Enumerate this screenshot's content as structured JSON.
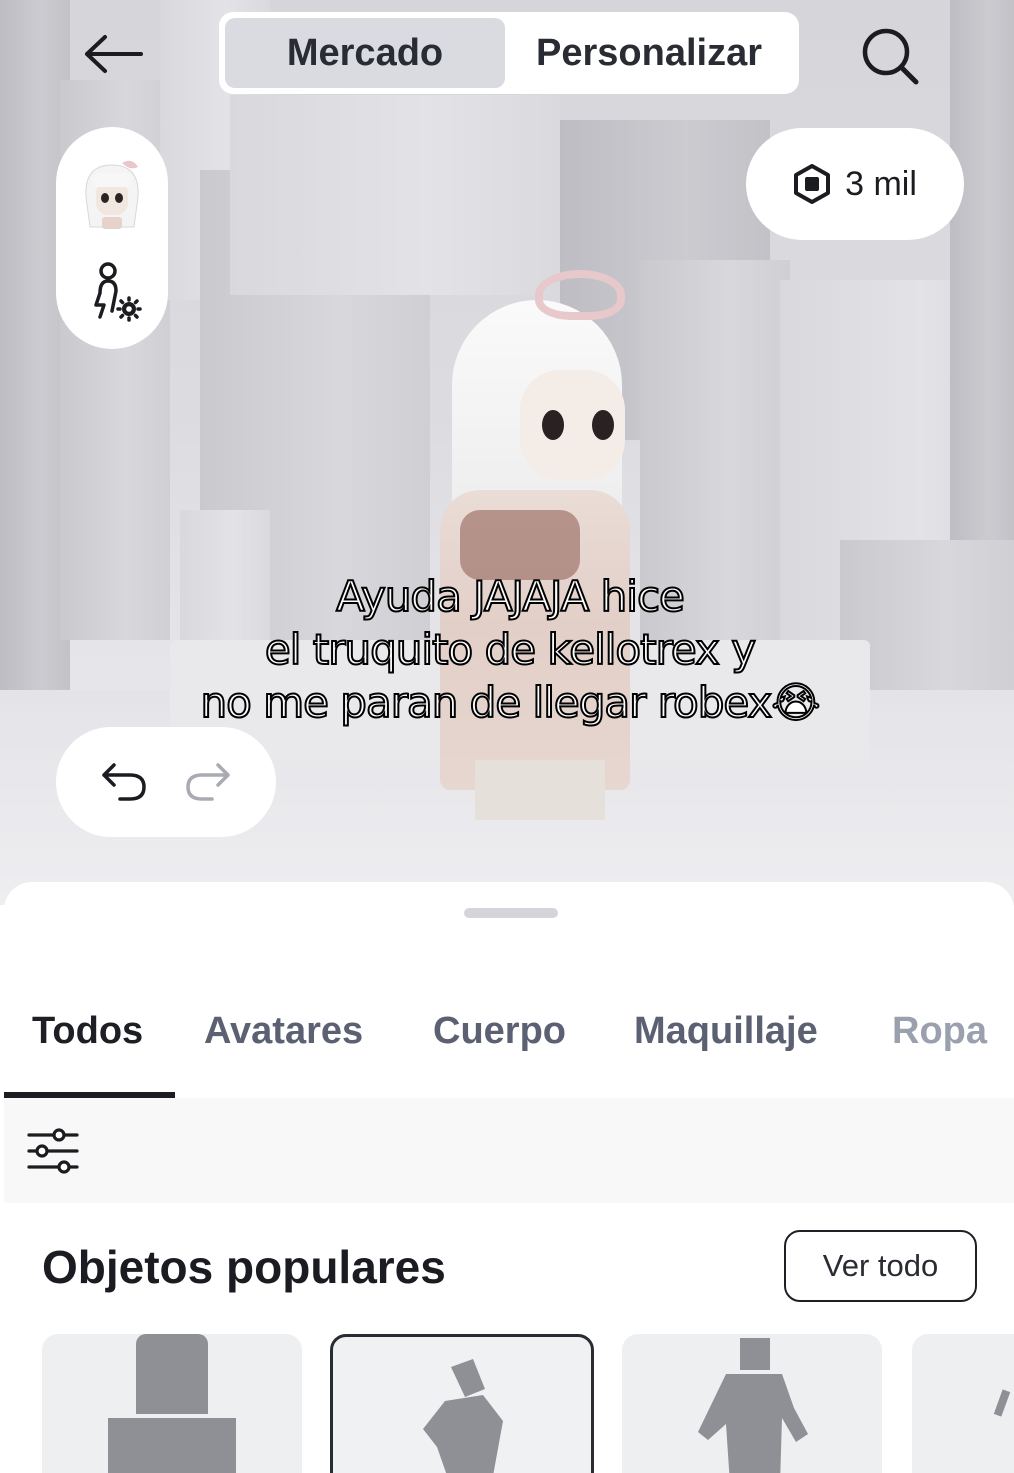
{
  "header": {
    "tabs": [
      {
        "label": "Mercado",
        "active": true
      },
      {
        "label": "Personalizar",
        "active": false
      }
    ],
    "icons": {
      "back": "back-arrow-icon",
      "search": "search-icon"
    }
  },
  "currency": {
    "amount": "3 mil",
    "icon": "robux-icon"
  },
  "side_panel": {
    "icons": [
      "avatar-head-icon",
      "body-settings-icon"
    ]
  },
  "caption": {
    "lines": [
      "Ayuda JAJAJA hice",
      "el truquito de kellotrex y",
      "no me paran de llegar robex😭"
    ]
  },
  "history": {
    "icons": [
      "undo-icon",
      "redo-icon"
    ]
  },
  "catalog": {
    "categories": [
      {
        "label": "Todos",
        "active": true
      },
      {
        "label": "Avatares",
        "active": false
      },
      {
        "label": "Cuerpo",
        "active": false
      },
      {
        "label": "Maquillaje",
        "active": false
      },
      {
        "label": "Ropa",
        "active": false
      }
    ],
    "filter_icon": "filter-sliders-icon",
    "section_title": "Objetos populares",
    "see_all_label": "Ver todo"
  },
  "colors": {
    "sheet_bg": "#ffffff",
    "active_tab_bg": "#d9dbe1",
    "text_dark": "#1e1f24",
    "text_muted": "#5b6072"
  }
}
